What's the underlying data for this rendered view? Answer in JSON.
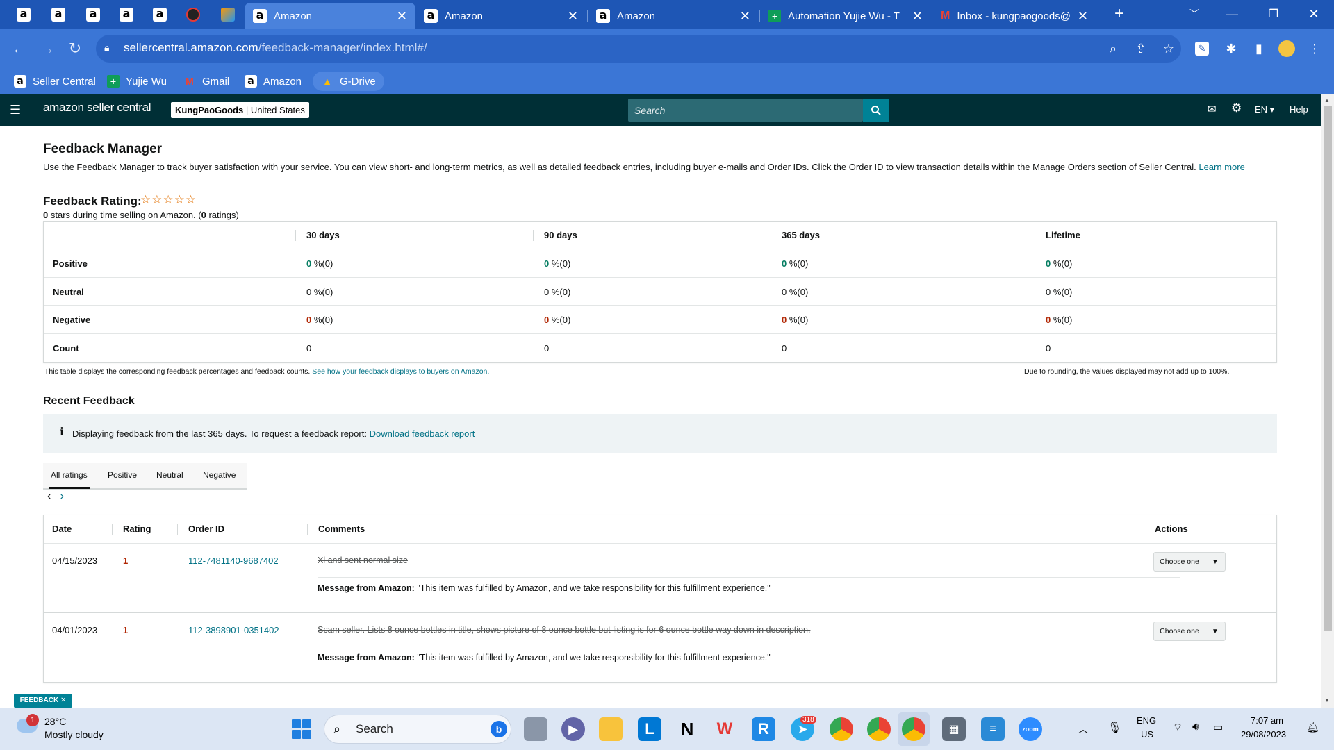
{
  "browser": {
    "pinned_tab_count": 6,
    "tabs": [
      {
        "title": "Amazon",
        "active": true
      },
      {
        "title": "Amazon",
        "active": false
      },
      {
        "title": "Amazon",
        "active": false
      },
      {
        "title": "Automation Yujie Wu - T",
        "active": false
      },
      {
        "title": "Inbox - kungpaogoods@",
        "active": false
      }
    ],
    "url_host": "sellercentral.amazon.com",
    "url_path": "/feedback-manager/index.html#/",
    "bookmarks": [
      {
        "label": "Seller Central",
        "icon": "amazon-icon"
      },
      {
        "label": "Yujie Wu",
        "icon": "sheets-icon"
      },
      {
        "label": "Gmail",
        "icon": "gmail-icon"
      },
      {
        "label": "Amazon",
        "icon": "amazon-icon"
      },
      {
        "label": "G-Drive",
        "icon": "drive-icon"
      }
    ]
  },
  "header": {
    "logo": "amazon seller central",
    "store_name": "KungPaoGoods",
    "store_region": "United States",
    "search_placeholder": "Search",
    "language": "EN",
    "help": "Help"
  },
  "page": {
    "title": "Feedback Manager",
    "intro": "Use the Feedback Manager to track buyer satisfaction with your service. You can view short- and long-term metrics, as well as detailed feedback entries, including buyer e-mails and Order IDs. Click the Order ID to view transaction details within the Manage Orders section of Seller Central.",
    "learn_more": "Learn more",
    "rating_title": "Feedback Rating:",
    "rating_stars": "☆☆☆☆☆",
    "rating_stars_value": 0,
    "rating_sub_a": "0",
    "rating_sub_b": " stars during time selling on Amazon. (",
    "rating_sub_c": "0",
    "rating_sub_d": " ratings)"
  },
  "metrics": {
    "columns": [
      "30 days",
      "90 days",
      "365 days",
      "Lifetime"
    ],
    "rows": [
      {
        "label": "Positive",
        "values": [
          {
            "n": "0",
            "rest": " %(0)"
          },
          {
            "n": "0",
            "rest": " %(0)"
          },
          {
            "n": "0",
            "rest": " %(0)"
          },
          {
            "n": "0",
            "rest": " %(0)"
          }
        ]
      },
      {
        "label": "Neutral",
        "values": [
          {
            "n": "0",
            "rest": " %(0)"
          },
          {
            "n": "0",
            "rest": " %(0)"
          },
          {
            "n": "0",
            "rest": " %(0)"
          },
          {
            "n": "0",
            "rest": " %(0)"
          }
        ]
      },
      {
        "label": "Negative",
        "values": [
          {
            "n": "0",
            "rest": " %(0)"
          },
          {
            "n": "0",
            "rest": " %(0)"
          },
          {
            "n": "0",
            "rest": " %(0)"
          },
          {
            "n": "0",
            "rest": " %(0)"
          }
        ]
      },
      {
        "label": "Count",
        "values": [
          {
            "n": "0",
            "rest": ""
          },
          {
            "n": "0",
            "rest": ""
          },
          {
            "n": "0",
            "rest": ""
          },
          {
            "n": "0",
            "rest": ""
          }
        ]
      }
    ],
    "note": "This table displays the corresponding feedback percentages and feedback counts.",
    "note_link": "See how your feedback displays to buyers on Amazon.",
    "rounding_note": "Due to rounding, the values displayed may not add up to 100%."
  },
  "recent": {
    "title": "Recent Feedback",
    "info_text": "Displaying feedback from the last 365 days. To request a feedback report:",
    "info_link": "Download feedback report",
    "tabs": [
      "All ratings",
      "Positive",
      "Neutral",
      "Negative"
    ],
    "columns": [
      "Date",
      "Rating",
      "Order ID",
      "Comments",
      "Actions"
    ],
    "rows": [
      {
        "date": "04/15/2023",
        "rating": "1",
        "order_id": "112-7481140-9687402",
        "comment": "Xl and sent normal size",
        "message_label": "Message from Amazon:",
        "message": " \"This item was fulfilled by Amazon, and we take responsibility for this fulfillment experience.\"",
        "action": "Choose one"
      },
      {
        "date": "04/01/2023",
        "rating": "1",
        "order_id": "112-3898901-0351402",
        "comment": "Scam seller. Lists 8 ounce bottles in title, shows picture of 8 ounce bottle but listing is for 6 ounce bottle way down in description.",
        "message_label": "Message from Amazon:",
        "message": " \"This item was fulfilled by Amazon, and we take responsibility for this fulfillment experience.\"",
        "action": "Choose one"
      }
    ],
    "feedback_tag": "FEEDBACK ✕"
  },
  "taskbar": {
    "weather_temp": "28°C",
    "weather_desc": "Mostly cloudy",
    "weather_badge": "1",
    "search": "Search",
    "telegram_badge": "318",
    "lang_top": "ENG",
    "lang_bottom": "US",
    "time": "7:07 am",
    "date": "29/08/2023"
  },
  "colors": {
    "tab_bar": "#1e56b5",
    "toolbar": "#3b76d6",
    "sc_header": "#002f36",
    "link": "#007185",
    "positive": "#067d62",
    "negative": "#b12704"
  }
}
